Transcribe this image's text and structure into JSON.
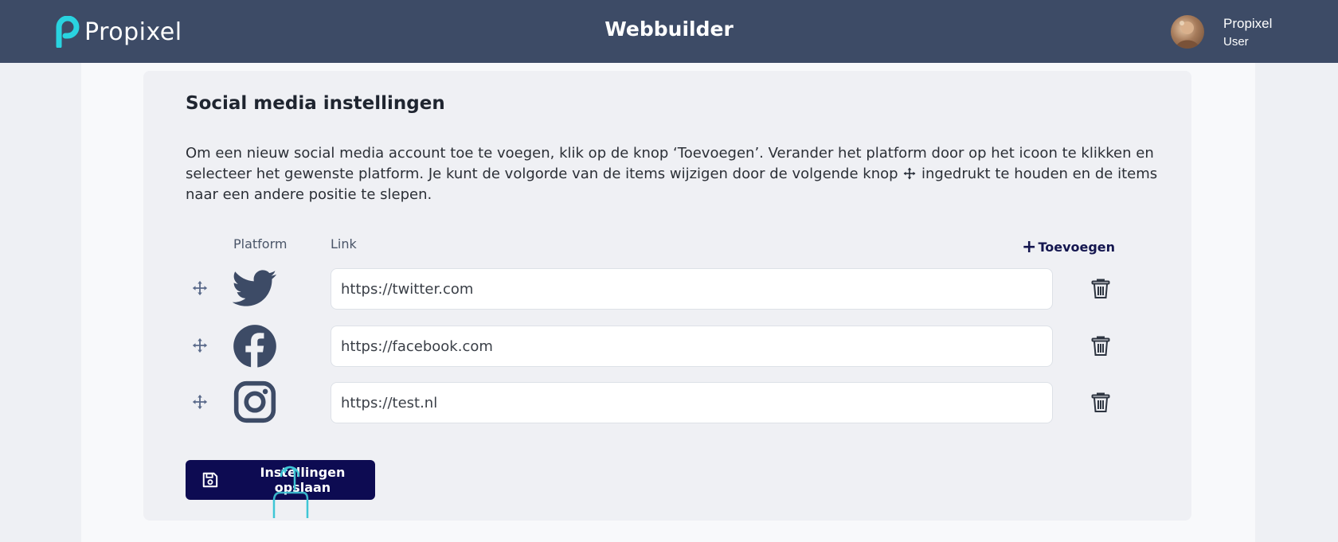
{
  "header": {
    "logo_text": "Propixel",
    "app_title": "Webbuilder",
    "user": {
      "name": "Propixel",
      "role": "User"
    }
  },
  "card": {
    "title": "Social media instellingen",
    "description_part1": "Om een nieuw social media account toe te voegen, klik op de knop ‘Toevoegen’. Verander het platform door op het icoon te klikken en selecteer het gewenste platform. Je kunt de volgorde van de items wijzigen door de volgende knop ",
    "description_part2": " ingedrukt te houden en de items naar een andere positie te slepen.",
    "columns": {
      "platform": "Platform",
      "link": "Link"
    },
    "add_label": "Toevoegen",
    "rows": [
      {
        "platform": "twitter",
        "link": "https://twitter.com"
      },
      {
        "platform": "facebook",
        "link": "https://facebook.com"
      },
      {
        "platform": "instagram",
        "link": "https://test.nl"
      }
    ],
    "save_label": "Instellingen opslaan"
  },
  "colors": {
    "header_bg": "#3d4b66",
    "logo_accent": "#29d3e0",
    "button_bg": "#0d0b52",
    "icon_color": "#3d4b66"
  }
}
